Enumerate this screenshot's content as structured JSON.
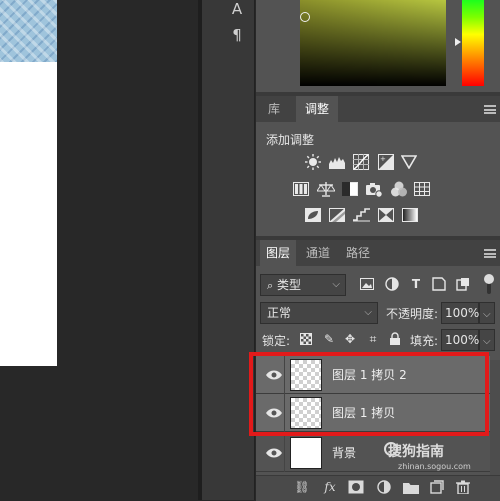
{
  "toolbar": {
    "type_tool_glyph": "A",
    "paragraph_glyph": "¶"
  },
  "adjustments_panel": {
    "tabs": [
      {
        "label": "库",
        "active": false
      },
      {
        "label": "调整",
        "active": true
      }
    ],
    "heading": "添加调整",
    "icons_row1": [
      "brightness-icon",
      "levels-icon",
      "curves-icon",
      "exposure-icon",
      "vibrance-icon"
    ],
    "icons_row2": [
      "hue-saturation-icon",
      "color-balance-icon",
      "black-white-icon",
      "photo-filter-icon",
      "channel-mixer-icon",
      "color-lookup-icon"
    ],
    "icons_row3": [
      "invert-icon",
      "posterize-icon",
      "threshold-icon",
      "selective-color-icon",
      "gradient-map-icon"
    ]
  },
  "layers_panel": {
    "tabs": [
      {
        "label": "图层",
        "active": true
      },
      {
        "label": "通道",
        "active": false
      },
      {
        "label": "路径",
        "active": false
      }
    ],
    "filter": {
      "label": "类型"
    },
    "blend_mode": "正常",
    "opacity_label": "不透明度:",
    "opacity_value": "100%",
    "lock_label": "锁定:",
    "fill_label": "填充:",
    "fill_value": "100%",
    "layers": [
      {
        "name": "图层 1 拷贝 2",
        "selected": true,
        "thumbnail": "transparent"
      },
      {
        "name": "图层 1 拷贝",
        "selected": true,
        "thumbnail": "transparent"
      },
      {
        "name": "背景",
        "selected": false,
        "thumbnail": "white"
      }
    ]
  },
  "bottom_icons": [
    "link-icon",
    "fx-icon",
    "mask-icon",
    "adjustment-layer-icon",
    "group-folder-icon",
    "new-layer-icon",
    "trash-icon"
  ],
  "watermark": {
    "text": "搜狗指南",
    "sub": "zhinan.sogou.com"
  },
  "colors": {
    "highlight": "#e21a1a",
    "panel_bg": "#535353",
    "selected_row": "#6a6a6a"
  }
}
